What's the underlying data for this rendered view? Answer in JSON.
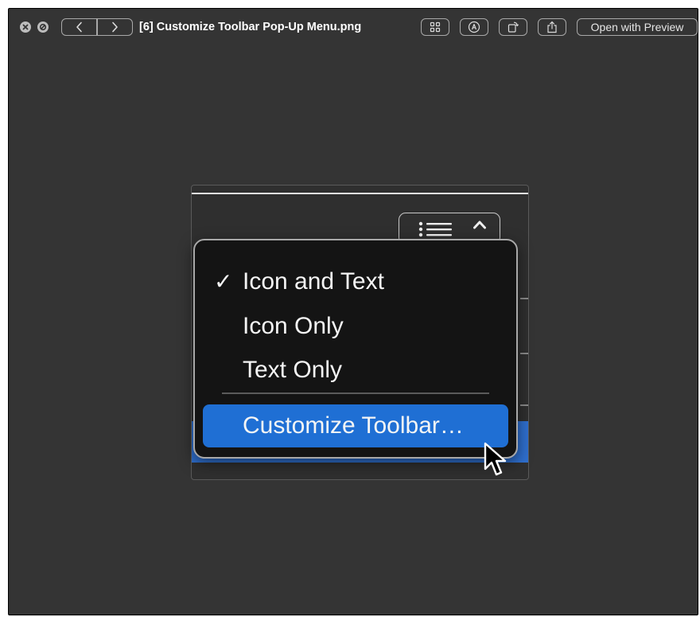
{
  "window": {
    "title": "[6] Customize Toolbar Pop-Up Menu.png",
    "controls": [
      "close-icon",
      "minimize-icon"
    ],
    "toolbar": {
      "back_icon": "chevron-left-icon",
      "forward_icon": "chevron-right-icon",
      "grid_icon": "grid-icon",
      "markup_icon": "markup-icon",
      "rotate_icon": "rotate-icon",
      "share_icon": "share-icon",
      "open_with_label": "Open with Preview"
    }
  },
  "menu": {
    "items": [
      {
        "label": "Icon and Text",
        "checked": true,
        "check": "✓"
      },
      {
        "label": "Icon Only",
        "checked": false
      },
      {
        "label": "Text Only",
        "checked": false
      }
    ],
    "highlighted_item": {
      "label": "Customize Toolbar…"
    }
  },
  "colors": {
    "window_bg": "#343434",
    "menu_bg": "#141414",
    "highlight": "#1f6fd4"
  }
}
